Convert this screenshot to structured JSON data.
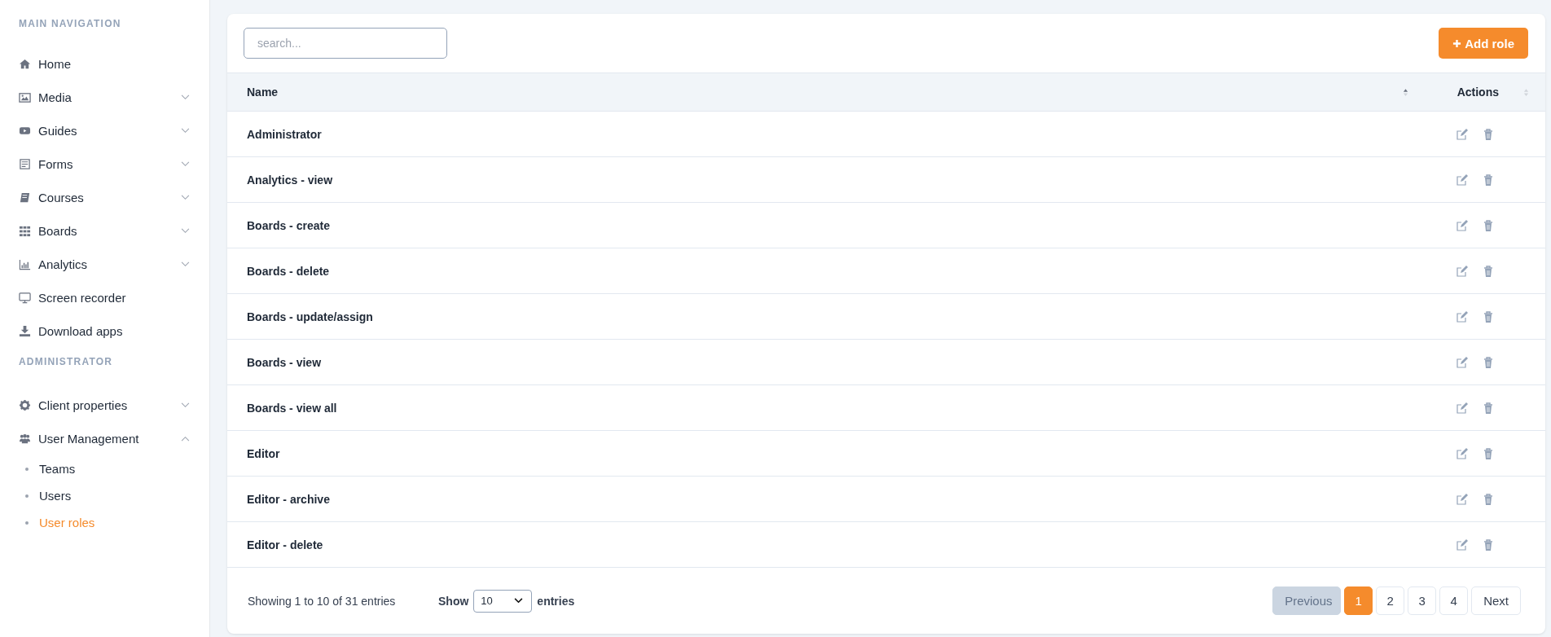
{
  "sidebar": {
    "sections": [
      {
        "heading": "MAIN NAVIGATION",
        "items": [
          {
            "label": "Home"
          },
          {
            "label": "Media",
            "expanded": false
          },
          {
            "label": "Guides",
            "expanded": false
          },
          {
            "label": "Forms",
            "expanded": false
          },
          {
            "label": "Courses",
            "expanded": false
          },
          {
            "label": "Boards",
            "expanded": false
          },
          {
            "label": "Analytics",
            "expanded": false
          },
          {
            "label": "Screen recorder"
          },
          {
            "label": "Download apps"
          }
        ]
      },
      {
        "heading": "ADMINISTRATOR",
        "items": [
          {
            "label": "Client properties",
            "expanded": false
          },
          {
            "label": "User Management",
            "expanded": true,
            "children": [
              {
                "label": "Teams",
                "selected": false
              },
              {
                "label": "Users",
                "selected": false
              },
              {
                "label": "User roles",
                "selected": true
              }
            ]
          }
        ]
      }
    ]
  },
  "toolbar": {
    "search": {
      "placeholder": "search..."
    },
    "add_button": "Add role"
  },
  "table": {
    "columns": [
      {
        "label": "Name",
        "sorted": true
      },
      {
        "label": "Actions",
        "sorted": false
      }
    ],
    "rows": [
      {
        "name": "Administrator"
      },
      {
        "name": "Analytics - view"
      },
      {
        "name": "Boards - create"
      },
      {
        "name": "Boards - delete"
      },
      {
        "name": "Boards - update/assign"
      },
      {
        "name": "Boards - view"
      },
      {
        "name": "Boards - view all"
      },
      {
        "name": "Editor"
      },
      {
        "name": "Editor - archive"
      },
      {
        "name": "Editor - delete"
      }
    ]
  },
  "footer": {
    "info": "Showing 1 to 10 of 31 entries",
    "show_label": "Show",
    "page_size": "10",
    "entries_label": "entries",
    "pagination": [
      {
        "label": "Previous",
        "kind": "nav",
        "disabled": true
      },
      {
        "label": "1",
        "kind": "page",
        "selected": true
      },
      {
        "label": "2",
        "kind": "page",
        "selected": false
      },
      {
        "label": "3",
        "kind": "page",
        "selected": false
      },
      {
        "label": "4",
        "kind": "page",
        "selected": false
      },
      {
        "label": "Next",
        "kind": "nav",
        "disabled": false
      }
    ]
  }
}
